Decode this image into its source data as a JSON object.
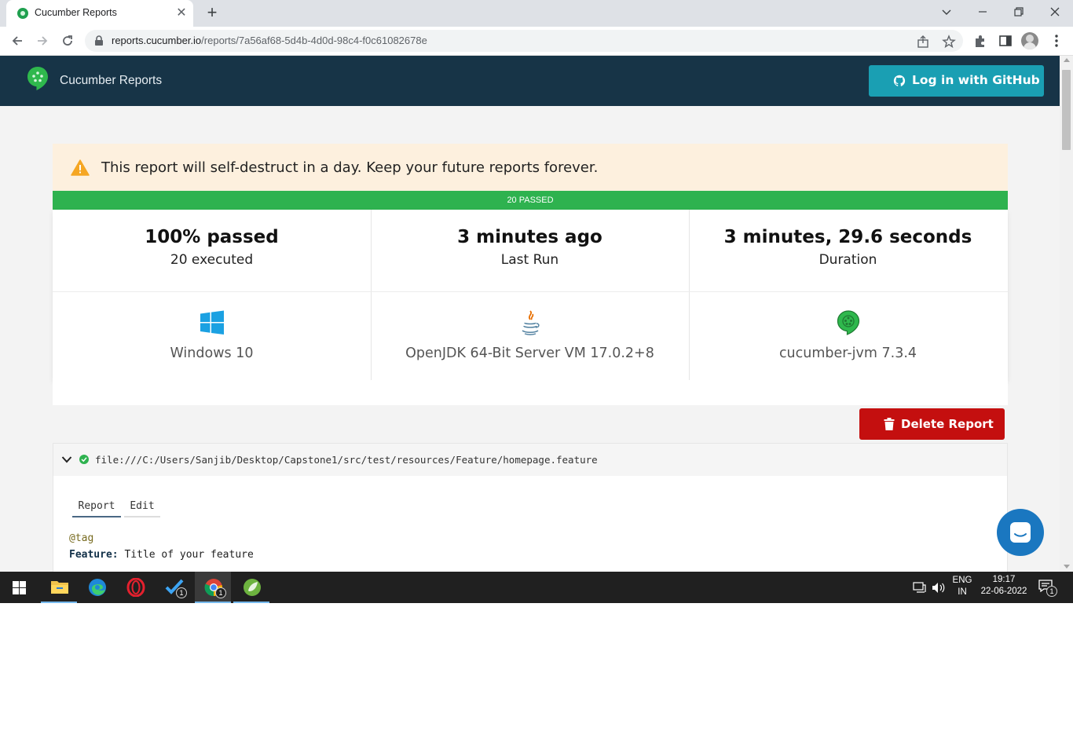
{
  "browser": {
    "tab_title": "Cucumber Reports",
    "new_tab": "+",
    "tab_close": "✕",
    "url_host": "reports.cucumber.io",
    "url_path": "/reports/7a56af68-5d4b-4d0d-98c4-f0c61082678e"
  },
  "header": {
    "brand": "Cucumber Reports",
    "github_button": "Log in with GitHub"
  },
  "warning": {
    "text": "This report will self-destruct in a day. Keep your future reports forever."
  },
  "summary": {
    "bar_label": "20 PASSED",
    "pass_fraction": 1.0,
    "passed_big": "100% passed",
    "passed_sub": "20 executed",
    "last_run_big": "3 minutes ago",
    "last_run_sub": "Last Run",
    "duration_big": "3 minutes, 29.6 seconds",
    "duration_sub": "Duration"
  },
  "environment": {
    "os": "Windows 10",
    "runtime": "OpenJDK 64-Bit Server VM 17.0.2+8",
    "implementation": "cucumber-jvm 7.3.4"
  },
  "actions": {
    "delete_button": "Delete Report"
  },
  "feature": {
    "path": "file:///C:/Users/Sanjib/Desktop/Capstone1/src/test/resources/Feature/homepage.feature",
    "tabs": [
      "Report",
      "Edit"
    ],
    "tag": "@tag",
    "keyword": "Feature:",
    "title": " Title of your feature"
  },
  "taskbar": {
    "vscode_badge": "1",
    "chrome_badge": "1",
    "lang_top": "ENG",
    "lang_bottom": "IN",
    "time": "19:17",
    "date": "22-06-2022",
    "notif_badge": "1"
  },
  "colors": {
    "header_bg": "#173447",
    "github_btn": "#1a9fb3",
    "warning_bg": "#fdf0de",
    "passed_green": "#2eb24f",
    "delete_red": "#c40f0f",
    "chat_blue": "#1a77c0"
  },
  "icons": {
    "tab": "cucumber-favicon",
    "nav": [
      "back-arrow-icon",
      "forward-arrow-icon",
      "reload-icon"
    ],
    "omnibox": [
      "lock-icon",
      "share-icon",
      "star-icon"
    ],
    "toolbar": [
      "extensions-icon",
      "side-panel-icon",
      "profile-avatar",
      "kebab-menu-icon"
    ],
    "page": [
      "cucumber-logo",
      "github-icon",
      "warning-icon",
      "windows-icon",
      "java-icon",
      "cucumber-icon",
      "trash-icon",
      "chevron-down-icon",
      "check-circle-icon",
      "chat-icon"
    ],
    "taskbar": [
      "windows-start-icon",
      "file-explorer-icon",
      "edge-icon",
      "opera-icon",
      "vscode-icon",
      "chrome-icon",
      "spring-tools-icon",
      "network-icon",
      "volume-icon",
      "notification-icon"
    ]
  }
}
